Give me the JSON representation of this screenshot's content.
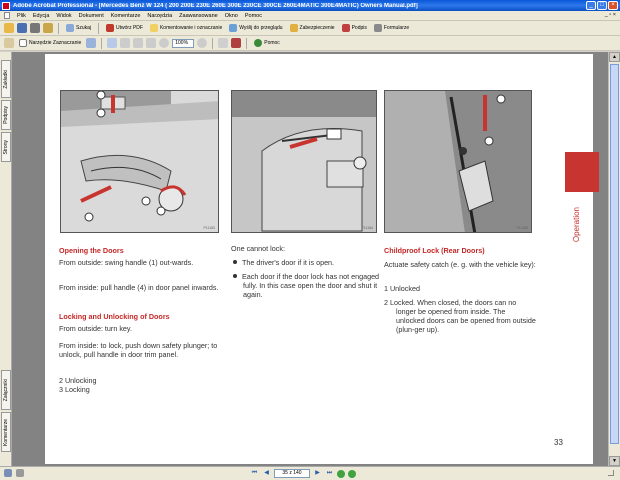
{
  "window": {
    "title": "Adobe Acrobat Professional - [Mercedes Benz W 124 ( 200 200E 230E 260E 300E 230CE 300CE 260E4MATIC 300E4MATIC) Owners Manual.pdf]",
    "controls": [
      "_",
      "□",
      "×"
    ]
  },
  "menubar": {
    "items": [
      "Plik",
      "Edycja",
      "Widok",
      "Dokument",
      "Komentarze",
      "Narzędzia",
      "Zaawansowane",
      "Okno",
      "Pomoc"
    ],
    "right_controls": "_ ▫ ×"
  },
  "toolbar1": {
    "items": [
      {
        "name": "open-icon",
        "color": "#e8b84a"
      },
      {
        "name": "save-icon",
        "color": "#4a6fb3"
      },
      {
        "name": "print-icon",
        "color": "#777777"
      },
      {
        "name": "email-icon",
        "color": "#caa54a"
      },
      {
        "name": "search-label",
        "label": "Szukaj"
      },
      {
        "name": "create-pdf",
        "label": "Utwórz PDF"
      },
      {
        "name": "comments",
        "label": "Komentowanie i oznaczanie"
      },
      {
        "name": "send-review",
        "label": "Wyślij do przeglądu"
      },
      {
        "name": "secure",
        "label": "Zabezpieczenie"
      },
      {
        "name": "sign",
        "label": "Podpis"
      },
      {
        "name": "forms",
        "label": "Formularze"
      }
    ]
  },
  "toolbar2": {
    "select_label": "Narzędzie Zaznaczanie",
    "zoom_value": "100%",
    "help_label": "Pomoc"
  },
  "left_tabs": [
    "Zakładki",
    "Podpisy",
    "Strony",
    "Załączniki",
    "Komentarze"
  ],
  "page": {
    "illustrations": [
      "P11183",
      "P11184",
      "P11185"
    ],
    "col1": {
      "heading1": "Opening the Doors",
      "p1": "From outside: swing handle (1) out-wards.",
      "p2": "From inside: pull handle (4) in door panel inwards.",
      "heading2": "Locking and Unlocking of Doors",
      "p3": "From outside: turn key.",
      "p4": "From inside: to lock, push down safety plunger; to unlock, pull handle in door trim panel.",
      "item2": "2   Unlocking",
      "item3": "3   Locking"
    },
    "col2": {
      "intro": "One cannot lock:",
      "bullet1": "The driver's door if it is open.",
      "bullet2": "Each door if the door lock has not engaged fully. In this case open the door and shut it again."
    },
    "col3": {
      "heading": "Childproof Lock (Rear Doors)",
      "p1": "Actuate safety catch (e. g. with the vehicle key):",
      "item1": "1   Unlocked",
      "item2": "2   Locked. When closed, the doors can no longer be opened from inside. The unlocked doors can be opened from outside (plun-ger up)."
    },
    "side_label": "Operation",
    "page_number": "33"
  },
  "statusbar": {
    "page_indicator": "35 z 140"
  }
}
